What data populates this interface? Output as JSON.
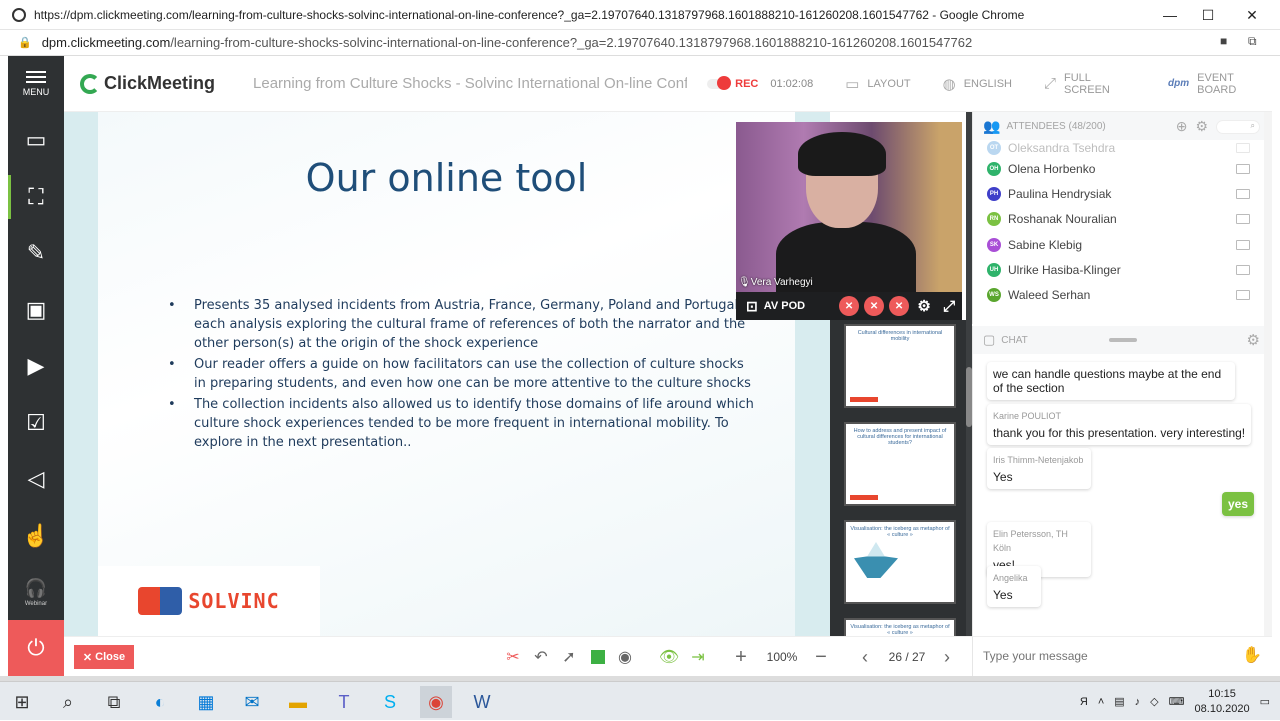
{
  "browser": {
    "window_title": "https://dpm.clickmeeting.com/learning-from-culture-shocks-solvinc-international-on-line-conference?_ga=2.19707640.1318797968.1601888210-161260208.1601547762 - Google Chrome",
    "url_domain": "dpm.clickmeeting.com",
    "url_path": "/learning-from-culture-shocks-solvinc-international-on-line-conference?_ga=2.19707640.1318797968.1601888210-161260208.1601547762"
  },
  "nav": {
    "menu_label": "MENU",
    "webinar_label": "Webinar"
  },
  "appbar": {
    "logo": "ClickMeeting",
    "event_title": "Learning from Culture Shocks - Solvinc International On-line Confer...",
    "rec_label": "REC",
    "rec_time": "01:02:08",
    "layout_label": "LAYOUT",
    "language_label": "ENGLISH",
    "fullscreen_label": "FULL SCREEN",
    "eventboard_label": "EVENT BOARD",
    "eventboard_logo": "dpm"
  },
  "slide": {
    "title": "Our online tool",
    "bullets": [
      "Presents 35 analysed incidents from Austria, France, Germany, Poland and Portugal, each analysis exploring the cultural frame of references of both the narrator and the other person(s) at the origin of the shock experience",
      "Our reader offers a guide on how facilitators can use the collection of culture shocks in preparing students, and even how one can be more attentive to the culture shocks",
      "The collection incidents also allowed us to identify those domains of life around which culture shock experiences tended to be more frequent in international mobility.  To explore in the next presentation.."
    ],
    "logo_text": "SOLVINC"
  },
  "video": {
    "presenter": "Vera Varhegyi",
    "pod_label": "AV POD"
  },
  "thumbnails": [
    {
      "title": "Cultural differences in international mobility"
    },
    {
      "title": "How to address and present impact of cultural differences for international students?"
    },
    {
      "title": "Visualisation: the iceberg as metaphor of « culture »"
    },
    {
      "title": "Visualisation: the iceberg as metaphor of « culture »"
    }
  ],
  "attendees": {
    "header": "ATTENDEES (48/200)",
    "list": [
      {
        "initials": "OT",
        "name": "Oleksandra Tsehdra",
        "color": "#3b8fd6"
      },
      {
        "initials": "OH",
        "name": "Olena Horbenko",
        "color": "#2fb36b"
      },
      {
        "initials": "PH",
        "name": "Paulina Hendrysiak",
        "color": "#3f3fc9"
      },
      {
        "initials": "RN",
        "name": "Roshanak Nouralian",
        "color": "#7bc142"
      },
      {
        "initials": "SK",
        "name": "Sabine Klebig",
        "color": "#a94fd6"
      },
      {
        "initials": "UH",
        "name": "Ulrike Hasiba-Klinger",
        "color": "#2fb36b"
      },
      {
        "initials": "WS",
        "name": "Waleed Serhan",
        "color": "#5aa62e"
      }
    ]
  },
  "chat": {
    "header": "CHAT",
    "messages": [
      {
        "author": "",
        "text": "we can handle questions maybe at the end of the section"
      },
      {
        "author": "Karine POULIOT",
        "text": "thank you for this presentation. very interesting!"
      },
      {
        "author": "Iris Thimm-Netenjakob",
        "text": "Yes"
      },
      {
        "author": "",
        "text": "yes"
      },
      {
        "author": "Elin Petersson, TH Köln",
        "text": "yes!"
      },
      {
        "author": "Angelika",
        "text": "Yes"
      }
    ],
    "input_placeholder": "Type your message"
  },
  "toolbar": {
    "close_label": "Close",
    "zoom": "100%",
    "page_indicator": "26 / 27"
  },
  "taskbar": {
    "time": "10:15",
    "date": "08.10.2020",
    "lang": "Я"
  }
}
